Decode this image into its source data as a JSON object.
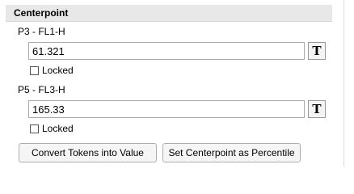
{
  "section": {
    "title": "Centerpoint"
  },
  "fields": [
    {
      "label": "P3 - FL1-H",
      "value": "61.321",
      "token_icon": "T",
      "locked_label": "Locked",
      "locked": false
    },
    {
      "label": "P5 - FL3-H",
      "value": "165.33",
      "token_icon": "T",
      "locked_label": "Locked",
      "locked": false
    }
  ],
  "buttons": {
    "convert_label": "Convert Tokens into Value",
    "percentile_label": "Set Centerpoint as Percentile"
  }
}
